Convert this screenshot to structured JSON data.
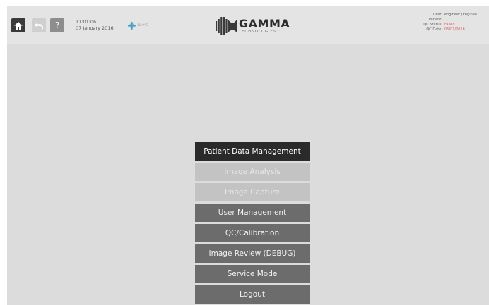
{
  "header": {
    "time": "11:01:06",
    "date": "07 January 2016",
    "temperature": "18.9°C",
    "help_label": "?",
    "logo": {
      "name": "GAMMA",
      "subtitle": "TECHNOLOGIES™"
    }
  },
  "status": {
    "user_label": "User:",
    "user_value": "engineer (Enginee",
    "patient_label": "Patient:",
    "patient_value": "",
    "qc_status_label": "QC Status:",
    "qc_status_value": "Failed",
    "qc_date_label": "QC Date:",
    "qc_date_value": "05/01/2016"
  },
  "menu": {
    "items": [
      {
        "label": "Patient Data Management",
        "state": "selected"
      },
      {
        "label": "Image Analysis",
        "state": "disabled"
      },
      {
        "label": "Image Capture",
        "state": "disabled"
      },
      {
        "label": "User Management",
        "state": "enabled"
      },
      {
        "label": "QC/Calibration",
        "state": "enabled"
      },
      {
        "label": "Image Review (DEBUG)",
        "state": "enabled"
      },
      {
        "label": "Service Mode",
        "state": "enabled"
      },
      {
        "label": "Logout",
        "state": "enabled"
      }
    ]
  },
  "colors": {
    "screen_background": "#dcdcdc",
    "header_background": "#e4e4e4",
    "menu_selected": "#2a2a2a",
    "menu_enabled": "#6c6c6c",
    "menu_disabled": "#c3c3c3",
    "alert_text": "#d96060",
    "temperature_icon": "#4aa3c7"
  },
  "icons": {
    "home": "home-icon",
    "back": "back-arrow-icon",
    "temperature": "temperature-icon",
    "logo": "gamma-logo-mark"
  }
}
